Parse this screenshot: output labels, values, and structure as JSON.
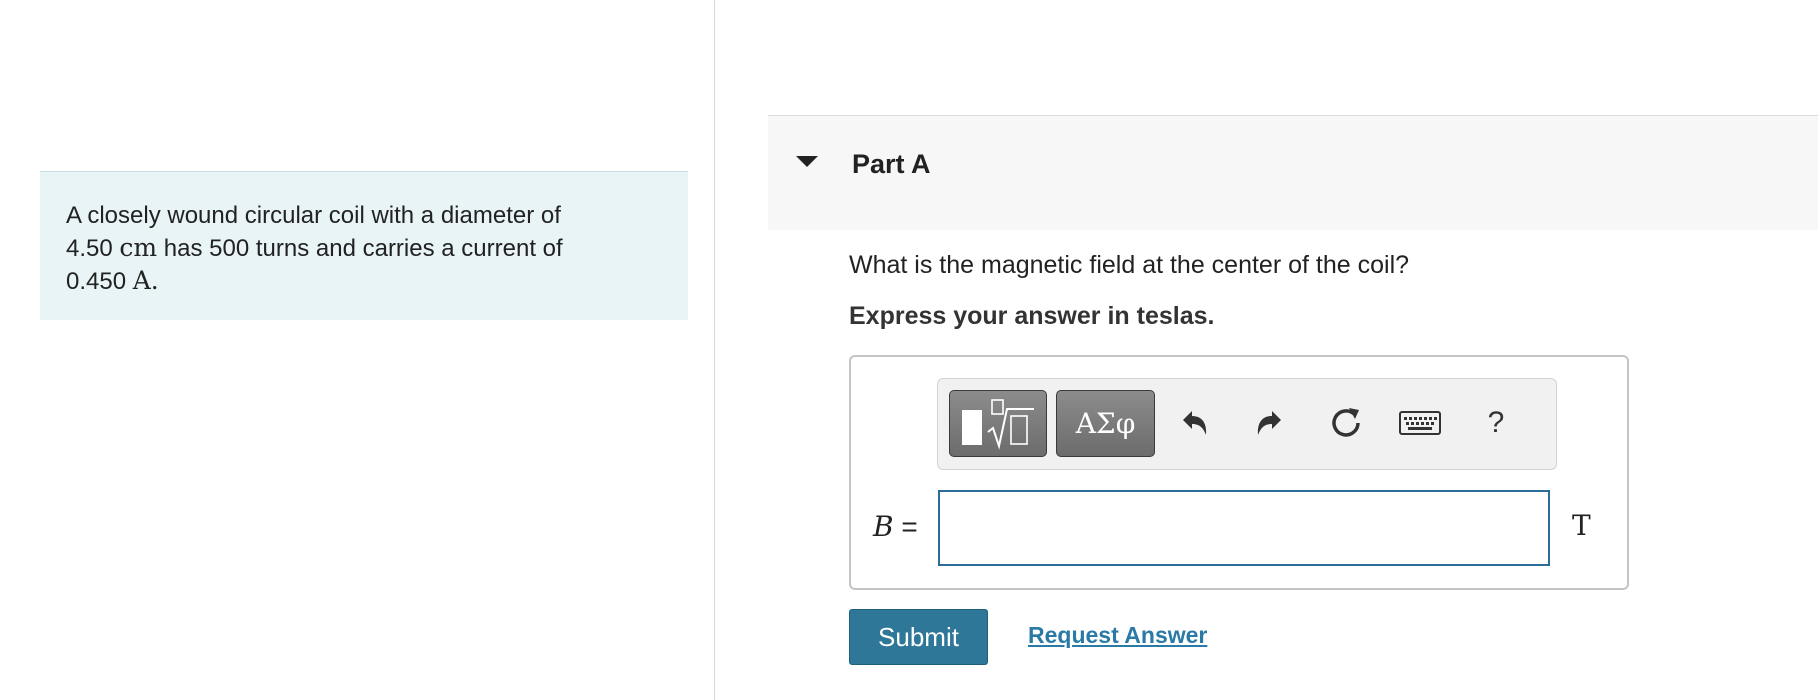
{
  "problem": {
    "line1": "A closely wound circular coil with a diameter of",
    "diameter_value": "4.50",
    "diameter_unit": "cm",
    "line2_rest": "has 500 turns and carries a current of",
    "current_value": "0.450",
    "current_unit": "A",
    "period": "."
  },
  "part": {
    "title": "Part A",
    "question": "What is the magnetic field at the center of the coil?",
    "instruction": "Express your answer in teslas."
  },
  "toolbar": {
    "templates_icon": "templates-sqrt-icon",
    "greek_label": "ΑΣφ",
    "undo_icon": "undo-icon",
    "redo_icon": "redo-icon",
    "reset_icon": "reset-icon",
    "keyboard_icon": "keyboard-icon",
    "help_label": "?"
  },
  "answer": {
    "variable": "B",
    "equals": "=",
    "value": "",
    "unit": "T"
  },
  "actions": {
    "submit_label": "Submit",
    "request_label": "Request Answer"
  },
  "colors": {
    "problem_bg": "#e8f4f6",
    "submit_bg": "#2e7798",
    "link": "#2a7aa6",
    "input_border": "#2c6c98"
  }
}
